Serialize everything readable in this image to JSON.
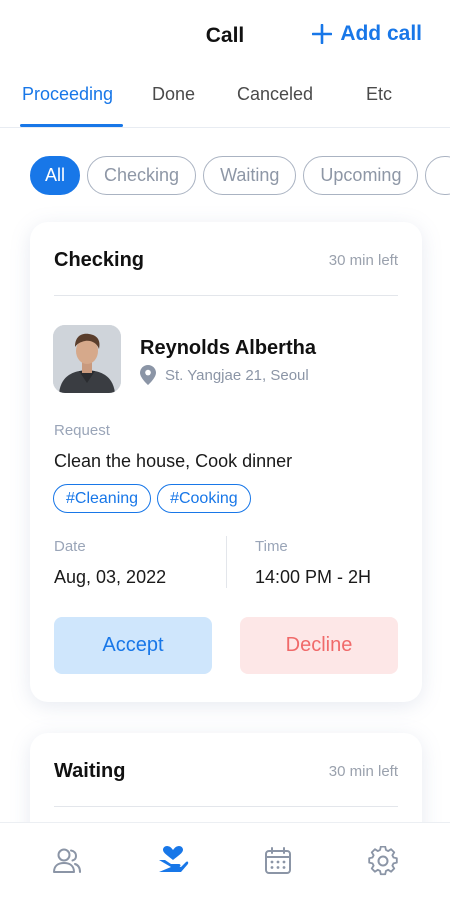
{
  "header": {
    "title": "Call",
    "add_call_label": "Add call"
  },
  "tabs": [
    {
      "label": "Proceeding",
      "active": true
    },
    {
      "label": "Done",
      "active": false
    },
    {
      "label": "Canceled",
      "active": false
    },
    {
      "label": "Etc",
      "active": false
    }
  ],
  "filters": [
    {
      "label": "All",
      "active": true
    },
    {
      "label": "Checking",
      "active": false
    },
    {
      "label": "Waiting",
      "active": false
    },
    {
      "label": "Upcoming",
      "active": false
    }
  ],
  "cards": [
    {
      "status": "Checking",
      "time_left": "30 min left",
      "client_name": "Reynolds Albertha",
      "address": "St. Yangjae 21, Seoul",
      "request_label": "Request",
      "request_text": "Clean the house, Cook dinner",
      "tags": [
        "#Cleaning",
        "#Cooking"
      ],
      "date_label": "Date",
      "date_value": "Aug, 03, 2022",
      "time_label": "Time",
      "time_value": "14:00 PM - 2H",
      "accept_label": "Accept",
      "decline_label": "Decline"
    },
    {
      "status": "Waiting",
      "time_left": "30 min left"
    }
  ],
  "bottom_nav": [
    {
      "icon": "users-icon",
      "active": false
    },
    {
      "icon": "hand-heart-icon",
      "active": true
    },
    {
      "icon": "calendar-icon",
      "active": false
    },
    {
      "icon": "gear-icon",
      "active": false
    }
  ],
  "colors": {
    "accent": "#1877e8",
    "accept_bg": "#cfe6fc",
    "decline_bg": "#fde7e7",
    "decline_text": "#f06a6a",
    "muted": "#9aa5b8"
  }
}
